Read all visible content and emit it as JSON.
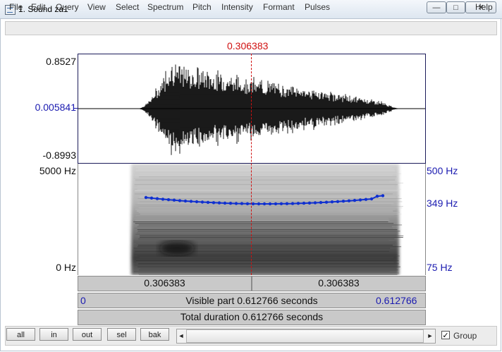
{
  "window": {
    "title": "1. Sound za1",
    "min_glyph": "—",
    "max_glyph": "□",
    "close_glyph": "✕"
  },
  "menu": [
    "File",
    "Edit",
    "Query",
    "View",
    "Select",
    "Spectrum",
    "Pitch",
    "Intensity",
    "Formant",
    "Pulses",
    "Help"
  ],
  "cursor_time": "0.306383",
  "waveform": {
    "y_max": "0.8527",
    "y_cursor": "0.005841",
    "y_min": "-0.8993"
  },
  "spectrogram": {
    "left_top": "5000 Hz",
    "left_bottom": "0 Hz",
    "right_top": "500 Hz",
    "right_mid": "349 Hz",
    "right_bottom": "75 Hz",
    "pitch_color": "#1030d0"
  },
  "bars": {
    "left_segment": "0.306383",
    "right_segment": "0.306383",
    "visible_start": "0",
    "visible_label": "Visible part 0.612766 seconds",
    "visible_end": "0.612766",
    "total_label": "Total duration 0.612766 seconds"
  },
  "toolbar": {
    "buttons": [
      "all",
      "in",
      "out",
      "sel",
      "bak"
    ],
    "scroll_left": "◄",
    "scroll_right": "►",
    "group_checked": true,
    "group_check_glyph": "✓",
    "group_label": "Group"
  }
}
